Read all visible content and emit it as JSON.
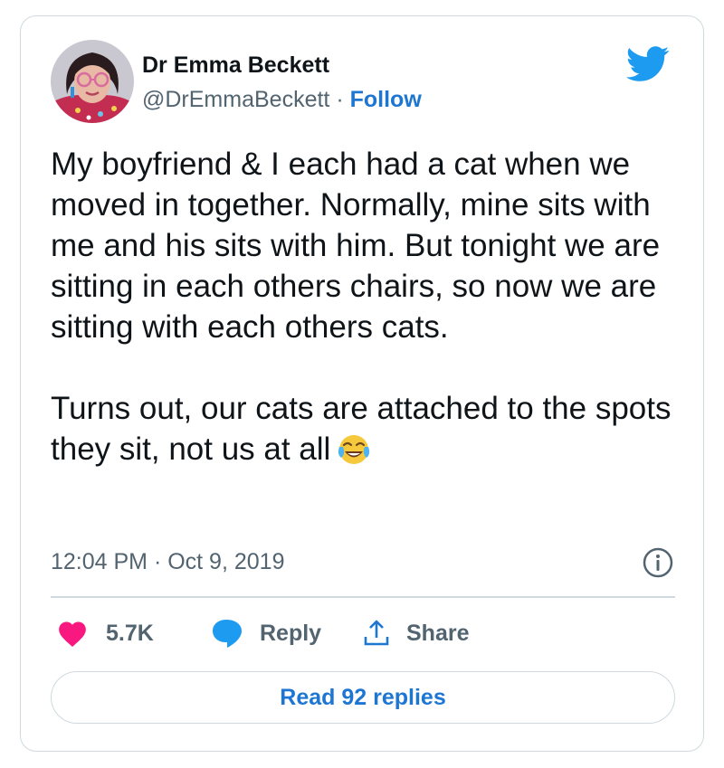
{
  "author": {
    "name": "Dr Emma Beckett",
    "handle": "@DrEmmaBeckett",
    "separator": "·",
    "follow_label": "Follow"
  },
  "tweet": {
    "text_paragraph_1": "My boyfriend & I each had a cat when we moved in together. Normally, mine sits with me and his sits with him. But tonight we are sitting in each others chairs, so now we are sitting with each others cats.",
    "text_paragraph_2": "Turns out, our cats are attached to the spots they sit, not us at all",
    "emoji": "face-with-tears-of-joy",
    "timestamp": "12:04 PM · Oct 9, 2019"
  },
  "actions": {
    "like_count": "5.7K",
    "reply_label": "Reply",
    "share_label": "Share"
  },
  "read_replies_label": "Read 92 replies",
  "icons": {
    "logo": "twitter-bird-icon",
    "like": "heart-icon",
    "reply": "speech-bubble-icon",
    "share": "share-upload-icon",
    "info": "info-icon"
  },
  "colors": {
    "brand": "#1d9bf0",
    "link": "#1d76d2",
    "like": "#f91880",
    "text": "#0f1419",
    "muted": "#536471",
    "border": "#cfd9de"
  }
}
